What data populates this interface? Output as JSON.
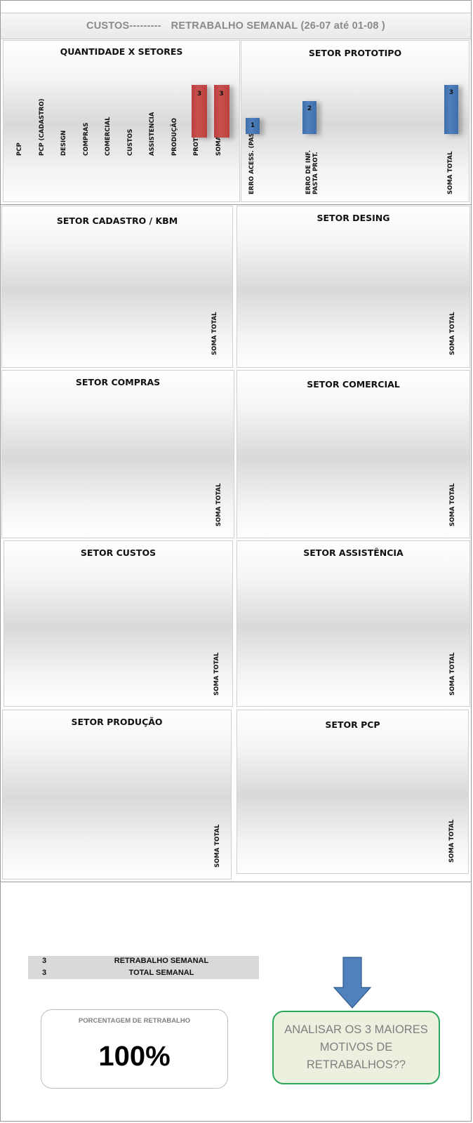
{
  "header": {
    "title_left": "CUSTOS---------",
    "title_right": "RETRABALHO SEMANAL (26-07 até 01-08 )"
  },
  "chart_data": [
    {
      "type": "bar",
      "title": "QUANTIDADE X SETORES",
      "categories": [
        "PCP",
        "PCP (CADASTRO)",
        "DESIGN",
        "COMPRAS",
        "COMERCIAL",
        "CUSTOS",
        "ASSISTENCIA",
        "PRODUÇÃO",
        "PROTOTIPO",
        "SOMA TOTAL"
      ],
      "values": [
        null,
        null,
        null,
        null,
        null,
        null,
        null,
        null,
        3,
        3
      ],
      "color": "#c0504d"
    },
    {
      "type": "bar",
      "title": "SETOR PROTOTIPO",
      "categories": [
        "ERRO ACESS. (PASTA)",
        "ERRO DE INF. PASTA PROT.",
        "SOMA TOTAL"
      ],
      "values": [
        1,
        2,
        3
      ],
      "color": "#4f81bd"
    },
    {
      "type": "bar",
      "title": "SETOR CADASTRO / KBM",
      "categories": [
        "SOMA TOTAL"
      ],
      "values": [
        null
      ]
    },
    {
      "type": "bar",
      "title": "SETOR DESING",
      "categories": [
        "SOMA TOTAL"
      ],
      "values": [
        null
      ]
    },
    {
      "type": "bar",
      "title": "SETOR COMPRAS",
      "categories": [
        "SOMA TOTAL"
      ],
      "values": [
        null
      ]
    },
    {
      "type": "bar",
      "title": "SETOR COMERCIAL",
      "categories": [
        "SOMA TOTAL"
      ],
      "values": [
        null
      ]
    },
    {
      "type": "bar",
      "title": "SETOR CUSTOS",
      "categories": [
        "SOMA TOTAL"
      ],
      "values": [
        null
      ]
    },
    {
      "type": "bar",
      "title": "SETOR ASSISTÊNCIA",
      "categories": [
        "SOMA TOTAL"
      ],
      "values": [
        null
      ]
    },
    {
      "type": "bar",
      "title": "SETOR PRODUÇÃO",
      "categories": [
        "SOMA TOTAL"
      ],
      "values": [
        null
      ]
    },
    {
      "type": "bar",
      "title": "SETOR PCP",
      "categories": [
        "SOMA TOTAL"
      ],
      "values": [
        null
      ]
    }
  ],
  "summary": {
    "rows": [
      {
        "value": "3",
        "label": "RETRABALHO SEMANAL"
      },
      {
        "value": "3",
        "label": "TOTAL  SEMANAL"
      }
    ]
  },
  "percentage": {
    "title": "PORCENTAGEM DE RETRABALHO",
    "value": "100%"
  },
  "callout": {
    "text": "ANALISAR OS 3 MAIORES MOTIVOS DE RETRABALHOS??"
  },
  "colors": {
    "bar_red": "#c0504d",
    "bar_blue": "#4f81bd",
    "callout_border": "#2aa85a",
    "callout_fill": "#ebf1de"
  }
}
